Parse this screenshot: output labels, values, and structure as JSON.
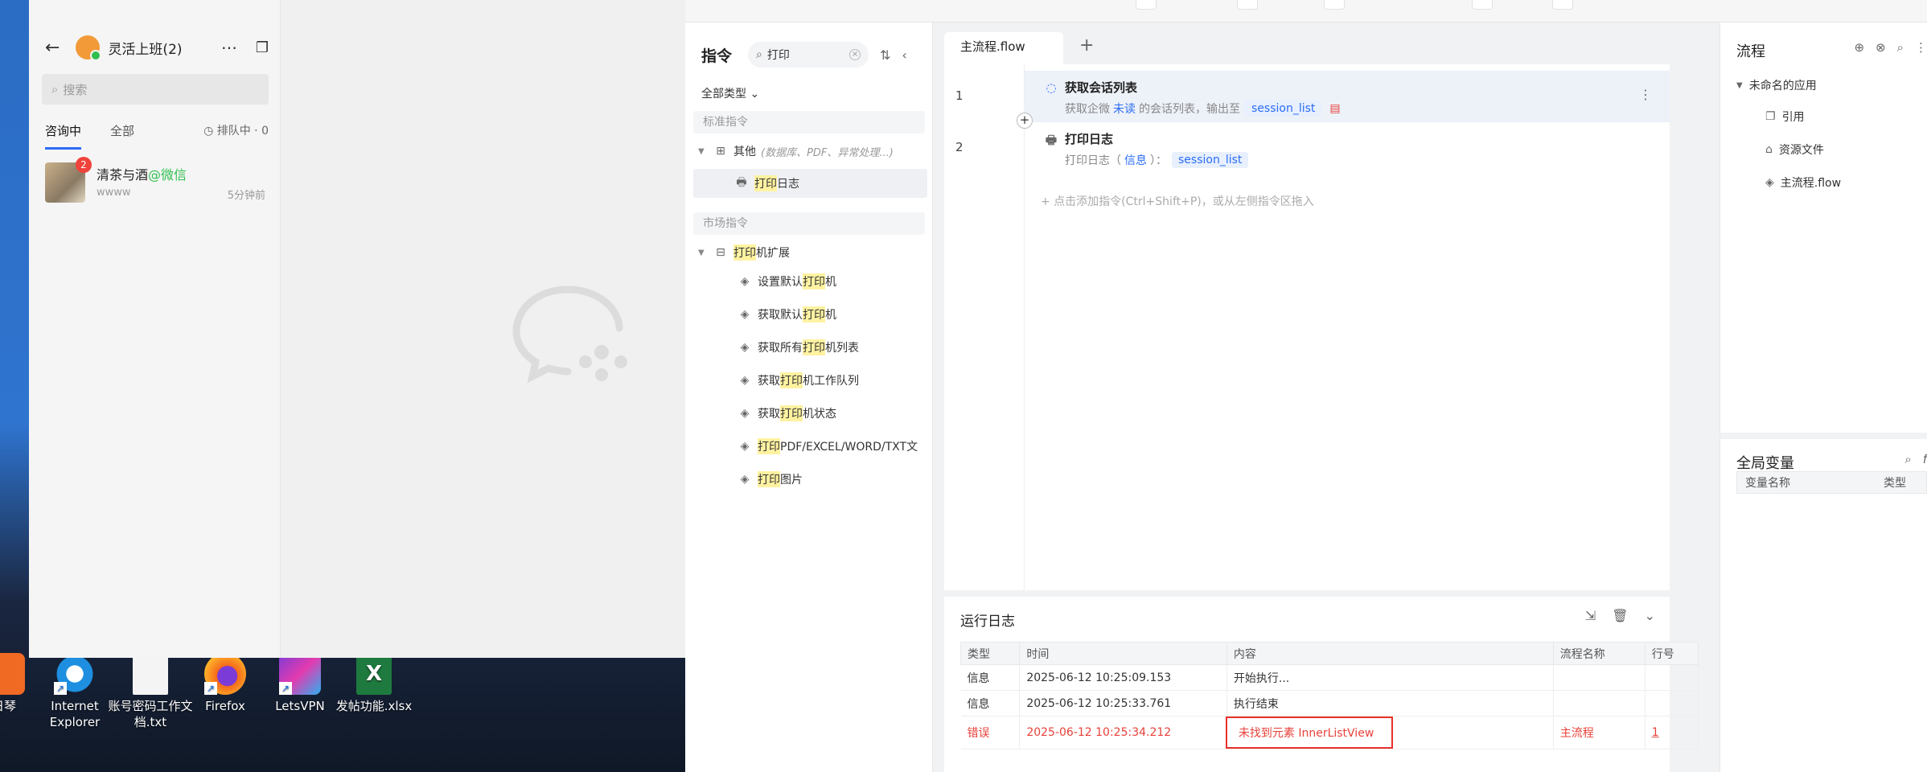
{
  "desktop": {
    "icons": [
      {
        "label": "日琴",
        "color": "#f06a24"
      },
      {
        "label": "Internet Explorer",
        "color": "#1e8fe0"
      },
      {
        "label": "账号密码工作文档.txt",
        "color": "#ffffff"
      },
      {
        "label": "Firefox",
        "color": "#f56b1a"
      },
      {
        "label": "LetsVPN",
        "color": "#7b3bd6"
      },
      {
        "label": "发帖功能.xlsx",
        "color": "#1f7a3f"
      }
    ]
  },
  "wecom": {
    "title": "灵活上班(2)",
    "search_placeholder": "搜索",
    "tabs": [
      {
        "label": "咨询中"
      },
      {
        "label": "全部"
      }
    ],
    "queue": "排队中 · 0",
    "conversation": {
      "name": "清茶与酒",
      "source": "@微信",
      "preview": "wwww",
      "time": "5分钟前",
      "unread": "2"
    }
  },
  "rpa": {
    "command_panel": {
      "title": "指令",
      "search_value": "打印",
      "filter_label": "全部类型",
      "group_standard": "标准指令",
      "other_label": "其他",
      "other_hint": "(数据库、PDF、异常处理...)",
      "print_log_hl": "打印",
      "print_log_rest": "日志",
      "group_market": "市场指令",
      "printer_ext_hl": "打印",
      "printer_ext_rest": "机扩展",
      "market_items": [
        {
          "pre": "设置默认",
          "hl": "打印",
          "post": "机"
        },
        {
          "pre": "获取默认",
          "hl": "打印",
          "post": "机"
        },
        {
          "pre": "获取所有",
          "hl": "打印",
          "post": "机列表"
        },
        {
          "pre": "获取",
          "hl": "打印",
          "post": "机工作队列"
        },
        {
          "pre": "获取",
          "hl": "打印",
          "post": "机状态"
        },
        {
          "pre": "",
          "hl": "打印",
          "post": "PDF/EXCEL/WORD/TXT文"
        },
        {
          "pre": "",
          "hl": "打印",
          "post": "图片"
        }
      ]
    },
    "editor": {
      "tab": "主流程.flow",
      "steps": [
        {
          "line": "1",
          "title": "获取会话列表",
          "desc_pre": "获取企微",
          "desc_kw": "未读",
          "desc_mid": "的会话列表，输出至",
          "var": "session_list"
        },
        {
          "line": "2",
          "title": "打印日志",
          "desc_pre": "打印日志（",
          "desc_kw": "信息",
          "desc_mid": "）：",
          "var": "session_list"
        }
      ],
      "add_hint": "点击添加指令(Ctrl+Shift+P)，或从左侧指令区拖入"
    },
    "log": {
      "title": "运行日志",
      "columns": [
        "类型",
        "时间",
        "内容",
        "流程名称",
        "行号"
      ],
      "rows": [
        {
          "type": "信息",
          "time": "2025-06-12 10:25:09.153",
          "content": "开始执行...",
          "flow": "",
          "line": ""
        },
        {
          "type": "信息",
          "time": "2025-06-12 10:25:33.761",
          "content": "执行结束",
          "flow": "",
          "line": ""
        },
        {
          "type": "错误",
          "time": "2025-06-12 10:25:34.212",
          "content": "未找到元素 InnerListView",
          "flow": "主流程",
          "line": "1"
        }
      ]
    },
    "flow_panel": {
      "title": "流程",
      "root": "未命名的应用",
      "items": [
        "引用",
        "资源文件",
        "主流程.flow"
      ]
    },
    "var_panel": {
      "title": "全局变量",
      "columns": [
        "变量名称",
        "类型"
      ]
    },
    "colors": {
      "accent": "#2b6cf6",
      "error": "#e8413a",
      "highlight": "#fff2a0"
    }
  }
}
